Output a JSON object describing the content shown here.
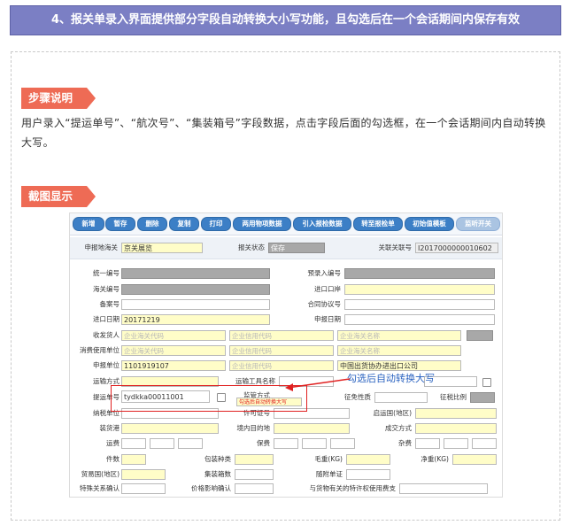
{
  "header": {
    "title": "4、报关单录入界面提供部分字段自动转换大小写功能，且勾选后在一个会话期间内保存有效"
  },
  "steps": {
    "heading": "步骤说明",
    "text": "用户录入“提运单号”、“航次号”、“集装箱号”字段数据，点击字段后面的勾选框，在一个会话期间内自动转换大写。"
  },
  "screenshot_section": {
    "heading": "截图显示"
  },
  "annotation": "勾选后自动转换大写",
  "app": {
    "toolbar": [
      "新增",
      "暂存",
      "删除",
      "复制",
      "打印",
      "两用物项数据",
      "引入报检数据",
      "转至报检单",
      "初始值模板",
      "监听开关"
    ],
    "row_top": {
      "apply_port_label": "申报地海关",
      "apply_port_value": "京关展览",
      "status_label": "报关状态",
      "status_value": "保存",
      "related_label": "关联关联号",
      "related_value": "I2017000000010602"
    },
    "labels": {
      "unified_no": "统一编号",
      "pre_entry_no": "预录入编号",
      "customs_no": "海关编号",
      "ie_port": "进口口岸",
      "record_no": "备案号",
      "contract_no": "合同协议号",
      "ie_date": "进口日期",
      "decl_date": "申报日期",
      "consignee": "收发货人",
      "consumer": "消费使用单位",
      "declarer": "申报单位",
      "transport": "运输方式",
      "vessel": "运输工具名称",
      "bill_no": "提运单号",
      "supervision": "监管方式",
      "tax_nature": "征免性质",
      "tax_ratio": "征税比例",
      "taxpayer": "纳税单位",
      "license": "许可证号",
      "start_country": "启运国(地区)",
      "ship_port": "装货港",
      "dest": "境内目的地",
      "deal_mode": "成交方式",
      "freight": "运费",
      "insurance": "保费",
      "misc": "杂费",
      "pieces": "件数",
      "pack": "包装种类",
      "gross": "毛重(KG)",
      "net": "净重(KG)",
      "trade_country": "贸易国(地区)",
      "container_count": "集装箱数",
      "attach_doc": "随附单证",
      "special_rel": "特殊关系确认",
      "price_impact": "价格影响确认",
      "royalty": "与货物有关的特许权使用费支"
    },
    "placeholders": {
      "customs_code": "企业海关代码",
      "credit_code": "企业信用代码",
      "customs_name": "企业海关名称"
    },
    "values": {
      "ie_date": "20171219",
      "declarer_code": "1101919107",
      "declarer_name": "中国出货协办进出口公司",
      "bill_no": "tydkka00011001",
      "supervision_tip": "勾选后自动转换大写"
    }
  },
  "colors": {
    "banner": "#7b7fc4",
    "ribbon": "#ee6b55",
    "highlight": "#e02020",
    "annotation": "#2a62c0",
    "required": "#fffdc8"
  }
}
